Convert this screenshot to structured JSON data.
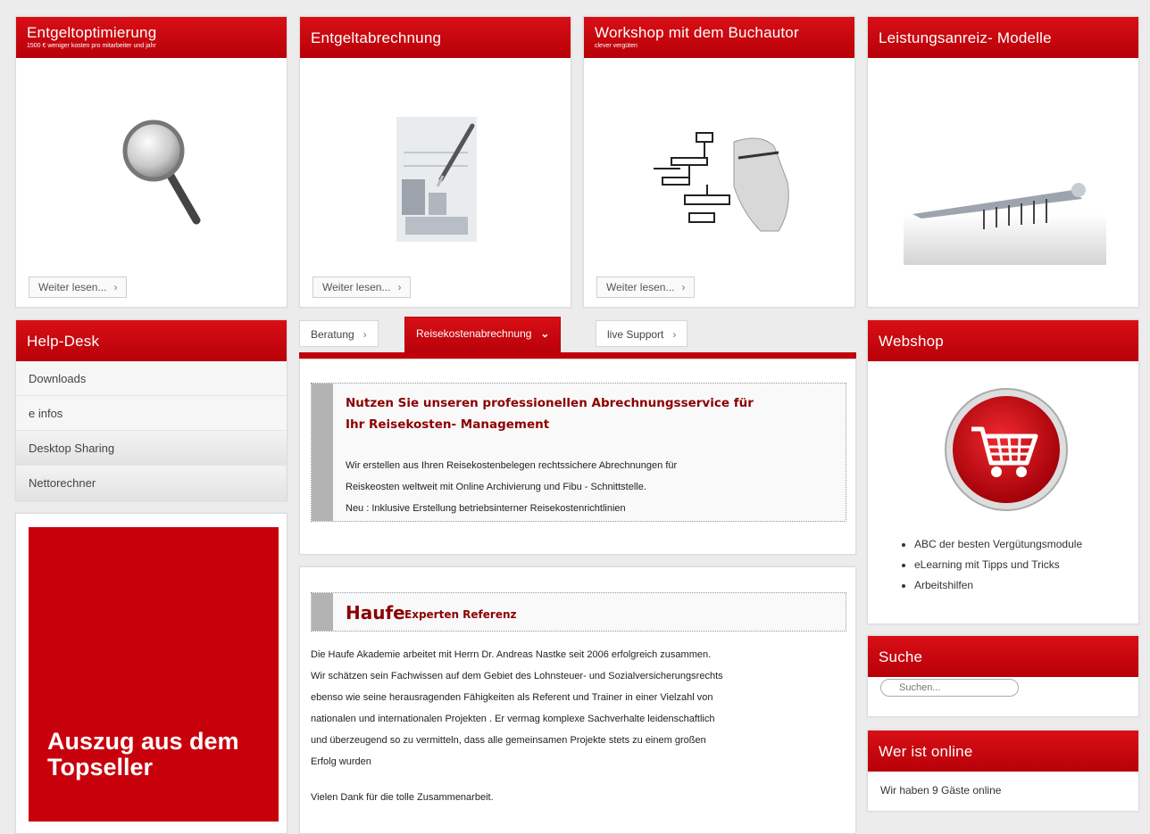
{
  "cards": {
    "entgeltoptimierung": {
      "title": "Entgeltoptimierung",
      "subtitle": "1500 € weniger kosten pro mitarbeiter und jahr",
      "more": "Weiter lesen..."
    },
    "entgeltabrechnung": {
      "title": "Entgeltabrechnung",
      "more": "Weiter lesen..."
    },
    "workshop": {
      "title": "Workshop mit dem Buchautor",
      "subtitle": "clever vergüten",
      "more": "Weiter lesen..."
    },
    "leistungsanreiz": {
      "title": "Leistungsanreiz- Modelle"
    }
  },
  "helpdesk": {
    "title": "Help-Desk",
    "items": [
      "Downloads",
      "e infos",
      "Desktop Sharing",
      "Nettorechner"
    ]
  },
  "topseller": {
    "text_line1": "Auszug aus dem",
    "text_line2": "Topseller"
  },
  "tabs": [
    "Beratung",
    "Reisekostenabrechnung",
    "live Support"
  ],
  "reisekosten": {
    "heading_line1": "Nutzen Sie unseren professionellen Abrechnungsservice für",
    "heading_line2": "Ihr Reisekosten- Management",
    "text_line1": "Wir erstellen aus Ihren Reisekostenbelegen rechtssichere Abrechnungen für",
    "text_line2": "Reiskeosten weltweit mit Online Archivierung und Fibu - Schnittstelle.",
    "text_line3": "Neu : Inklusive Erstellung betriebsinterner Reisekostenrichtlinien"
  },
  "haufe": {
    "brand": "Haufe",
    "tagline": "Experten Referenz",
    "lines": [
      "Die Haufe Akademie arbeitet mit Herrn Dr. Andreas Nastke seit 2006 erfolgreich zusammen.",
      "Wir schätzen sein Fachwissen auf dem Gebiet des Lohnsteuer- und Sozialversicherungsrechts",
      "ebenso wie seine herausragenden Fähigkeiten als Referent und Trainer in einer Vielzahl von",
      "nationalen und internationalen Projekten . Er vermag komplexe Sachverhalte leidenschaftlich",
      "und überzeugend so zu vermitteln, dass alle gemeinsamen Projekte stets zu einem großen",
      "Erfolg wurden"
    ],
    "thanks": "Vielen Dank für die tolle Zusammenarbeit."
  },
  "webshop": {
    "title": "Webshop",
    "links": [
      "ABC der besten Vergütungsmodule",
      "eLearning mit Tipps und Tricks",
      "Arbeitshilfen"
    ]
  },
  "suche": {
    "title": "Suche",
    "placeholder": "Suchen..."
  },
  "online": {
    "title": "Wer ist online",
    "text": "Wir haben 9 Gäste online"
  },
  "colors": {
    "accent": "#c8000c",
    "gray_bar": "#b3b3b3"
  },
  "icons": {
    "magnifier": "magnifier-icon",
    "cart": "shopping-cart-icon",
    "chevron": "chevron-right-icon"
  }
}
